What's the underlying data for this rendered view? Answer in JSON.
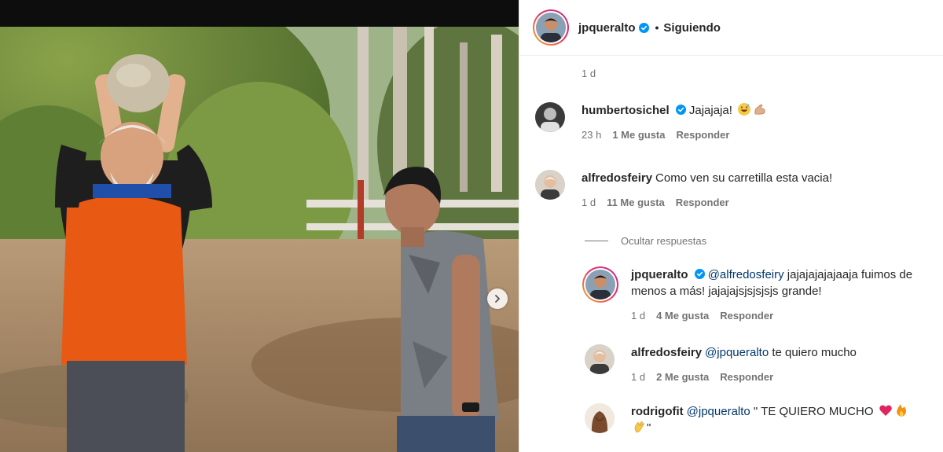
{
  "post": {
    "author": "jpqueralto",
    "follow_state": "Siguiendo",
    "separator": "•",
    "age": "1 d"
  },
  "comments": [
    {
      "user": "humbertosichel",
      "verified": true,
      "text": "Jajajaja!",
      "emojis": [
        "grinning-sweat-emoji",
        "flexed-biceps-emoji"
      ],
      "time": "23 h",
      "likes": "1 Me gusta",
      "reply_label": "Responder"
    },
    {
      "user": "alfredosfeiry",
      "text": "Como ven su carretilla esta vacia!",
      "time": "1 d",
      "likes": "11 Me gusta",
      "reply_label": "Responder"
    }
  ],
  "hide_replies_label": "Ocultar respuestas",
  "replies": [
    {
      "user": "jpqueralto",
      "verified": true,
      "mention": "@alfredosfeiry",
      "text": " jajajajajajaaja fuimos de menos a más! jajajajsjsjsjsjs grande!",
      "time": "1 d",
      "likes": "4 Me gusta",
      "reply_label": "Responder"
    },
    {
      "user": "alfredosfeiry",
      "mention": "@jpqueralto",
      "text": " te quiero mucho",
      "time": "1 d",
      "likes": "2 Me gusta",
      "reply_label": "Responder"
    },
    {
      "user": "rodrigofit",
      "mention": "@jpqueralto",
      "text": " \" TE QUIERO MUCHO ",
      "emojis": [
        "red-heart-emoji",
        "fire-emoji",
        "clapping-hands-emoji"
      ],
      "closing_quote": "\""
    }
  ],
  "colors": {
    "verified_blue": "#0095f6",
    "mention_blue": "#00376b",
    "meta_gray": "#737373",
    "text": "#262626"
  }
}
